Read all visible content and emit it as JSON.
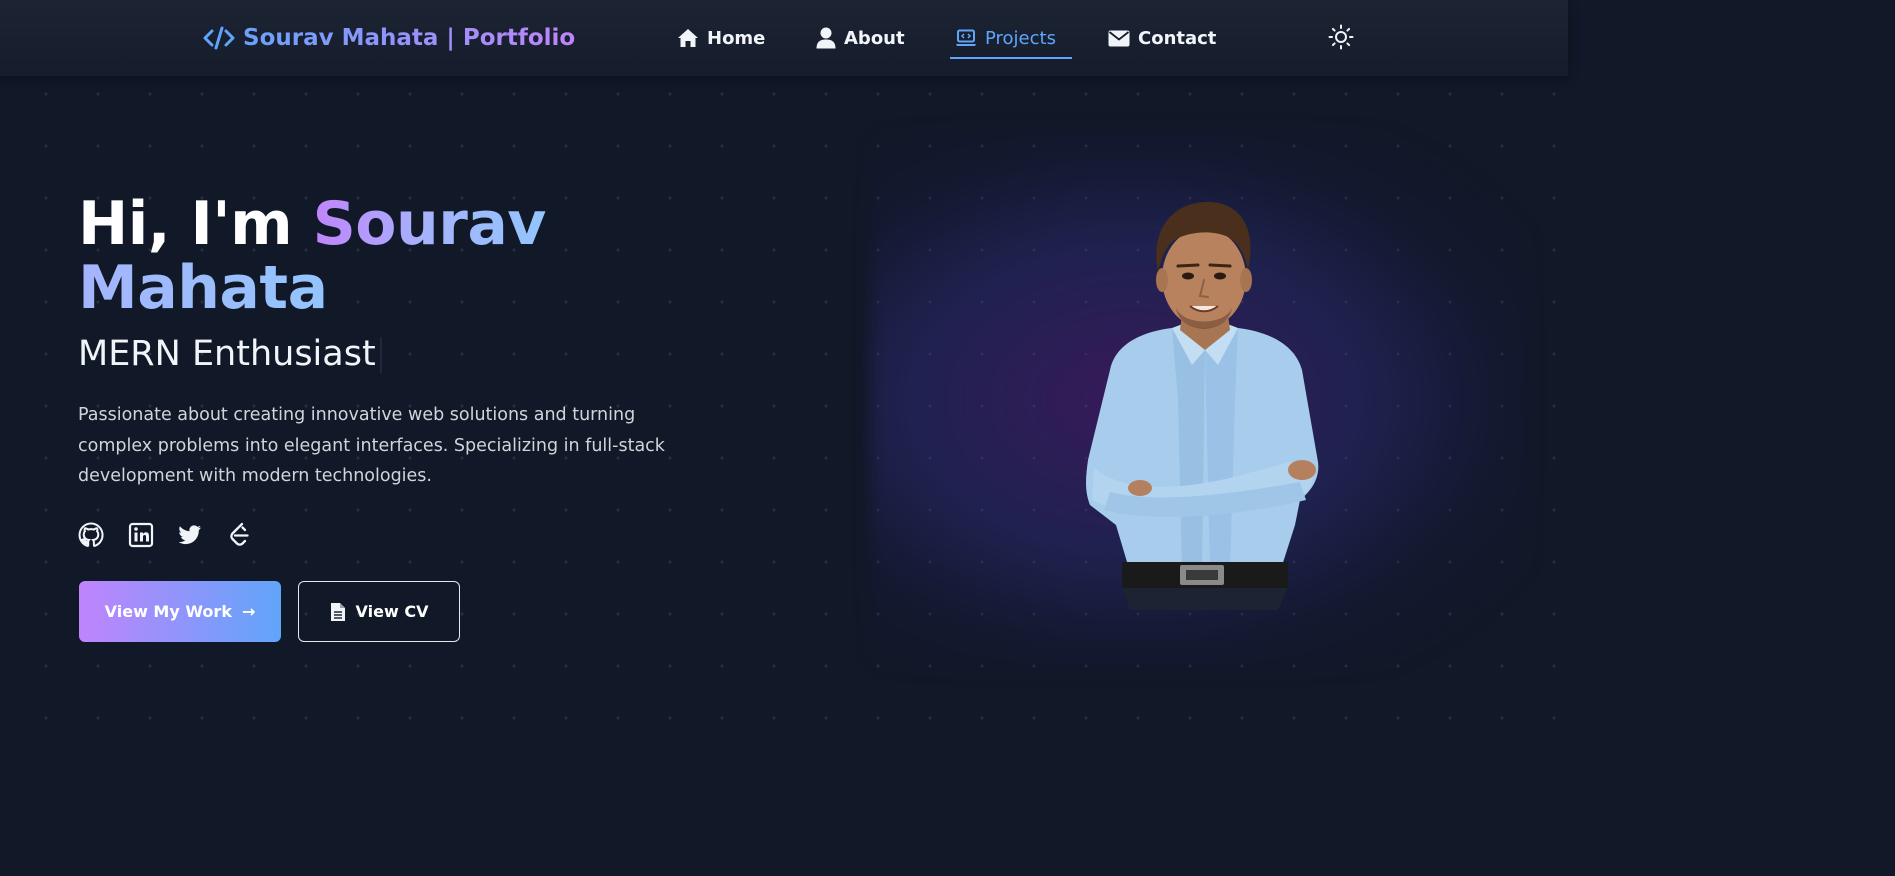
{
  "nav": {
    "brand": "Sourav Mahata | Portfolio",
    "items": [
      {
        "label": "Home",
        "icon": "home-icon"
      },
      {
        "label": "About",
        "icon": "user-icon"
      },
      {
        "label": "Projects",
        "icon": "laptop-code-icon",
        "active": true
      },
      {
        "label": "Contact",
        "icon": "envelope-icon"
      }
    ],
    "theme_toggle_icon": "sun-icon"
  },
  "hero": {
    "greeting": "Hi, I'm ",
    "first_name": "Sourav",
    "last_name": "Mahata",
    "role": "MERN Enthusiast",
    "description": "Passionate about creating innovative web solutions and turning complex problems into elegant interfaces. Specializing in full-stack development with modern technologies.",
    "socials": [
      "github-icon",
      "linkedin-icon",
      "twitter-icon",
      "leetcode-icon"
    ],
    "primary_button": "View My Work",
    "primary_button_arrow": "→",
    "secondary_button": "View CV"
  },
  "colors": {
    "background": "#111827",
    "accent_blue": "#60a5fa",
    "accent_purple": "#c084fc",
    "nav_bg": "#1c2433"
  }
}
